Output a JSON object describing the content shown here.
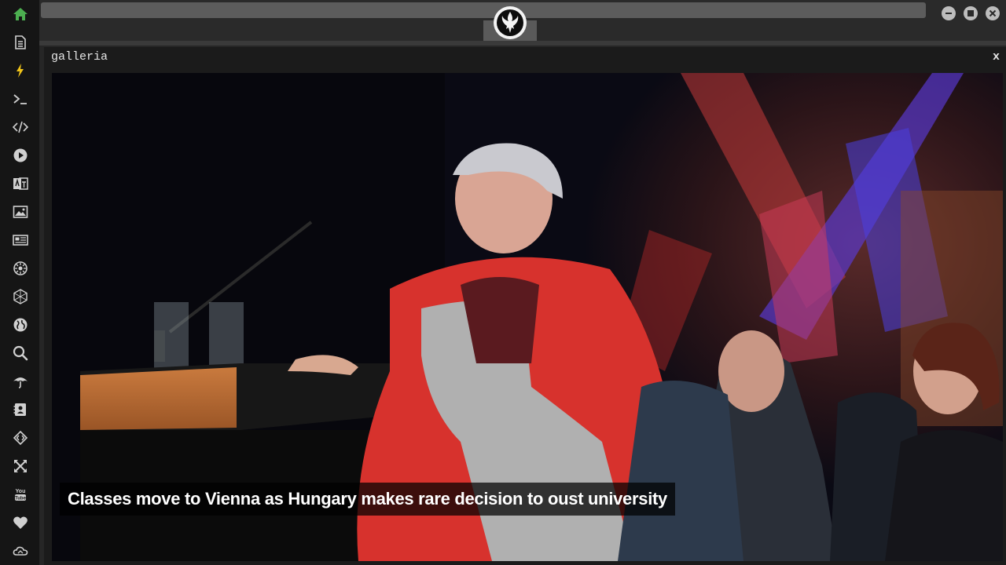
{
  "app": {
    "window_controls": [
      "minimize",
      "maximize",
      "close"
    ],
    "logo_icon": "rebel-alliance-icon"
  },
  "sidebar": {
    "items": [
      {
        "name": "home",
        "icon": "home-icon",
        "color": "#4caf50"
      },
      {
        "name": "document",
        "icon": "document-icon"
      },
      {
        "name": "flash",
        "icon": "lightning-icon",
        "color": "#f0c419"
      },
      {
        "name": "terminal",
        "icon": "terminal-icon"
      },
      {
        "name": "code",
        "icon": "code-icon"
      },
      {
        "name": "play",
        "icon": "play-icon"
      },
      {
        "name": "translate",
        "icon": "translate-icon"
      },
      {
        "name": "image",
        "icon": "image-icon"
      },
      {
        "name": "news",
        "icon": "newspaper-icon"
      },
      {
        "name": "settings",
        "icon": "gear-icon"
      },
      {
        "name": "network",
        "icon": "hexagon-icon"
      },
      {
        "name": "globe",
        "icon": "globe-icon"
      },
      {
        "name": "search",
        "icon": "search-icon"
      },
      {
        "name": "weather",
        "icon": "umbrella-icon"
      },
      {
        "name": "contacts",
        "icon": "contact-card-icon"
      },
      {
        "name": "embed",
        "icon": "diamond-code-icon"
      },
      {
        "name": "expand",
        "icon": "expand-icon"
      },
      {
        "name": "youtube",
        "icon": "youtube-icon"
      },
      {
        "name": "favorites",
        "icon": "heart-icon"
      },
      {
        "name": "cloud",
        "icon": "cloud-icon"
      }
    ]
  },
  "panel": {
    "title": "galleria",
    "close_label": "x"
  },
  "gallery": {
    "caption": "Classes move to Vienna as Hungary makes rare decision to oust university"
  }
}
